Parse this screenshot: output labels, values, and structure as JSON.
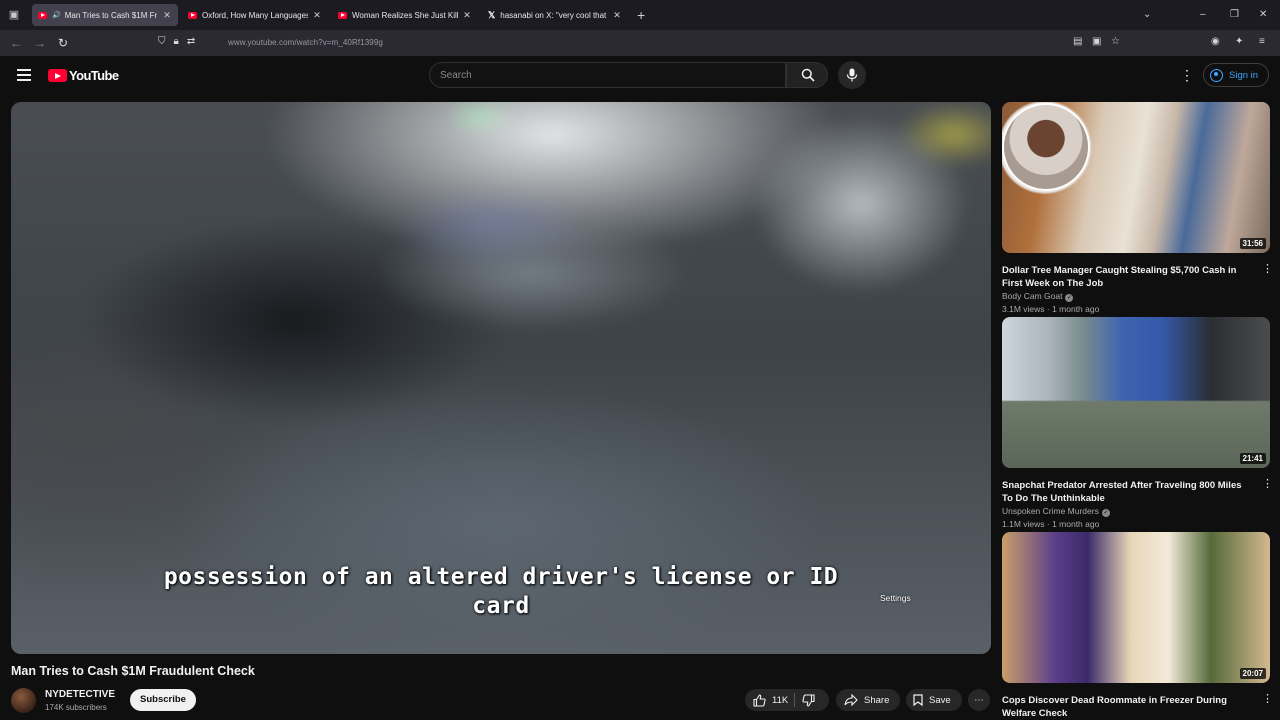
{
  "browser": {
    "tabs": [
      {
        "title": "Man Tries to Cash $1M Fr",
        "active": true,
        "type": "youtube"
      },
      {
        "title": "Oxford, How Many Languages I",
        "active": false,
        "type": "youtube"
      },
      {
        "title": "Woman Realizes She Just Killed",
        "active": false,
        "type": "youtube"
      },
      {
        "title": "hasanabi on X: \"very cool that e",
        "active": false,
        "type": "x"
      }
    ],
    "url": "www.youtube.com/watch?v=m_40Rf1399g"
  },
  "masthead": {
    "logo_text": "YouTube",
    "search_placeholder": "Search",
    "signin_label": "Sign in"
  },
  "player": {
    "caption_line1": "possession of an altered driver's license or ID",
    "caption_line2": "card",
    "settings_tooltip": "Settings"
  },
  "video": {
    "title": "Man Tries to Cash $1M Fraudulent Check",
    "channel_name": "NYDETECTIVE",
    "subscribers": "174K subscribers",
    "subscribe_label": "Subscribe",
    "likes": "11K",
    "share_label": "Share",
    "save_label": "Save"
  },
  "recommendations": [
    {
      "title": "Dollar Tree Manager Caught Stealing $5,700 Cash in First Week on The Job",
      "channel": "Body Cam Goat",
      "meta": "3.1M views · 1 month ago",
      "duration": "31:56",
      "verified": true
    },
    {
      "title": "Snapchat Predator Arrested After Traveling 800 Miles To Do The Unthinkable",
      "channel": "Unspoken Crime Murders",
      "meta": "1.1M views · 1 month ago",
      "duration": "21:41",
      "verified": true
    },
    {
      "title": "Cops Discover Dead Roommate in Freezer During Welfare Check",
      "channel": "",
      "meta": "",
      "duration": "20:07",
      "verified": false
    }
  ],
  "colors": {
    "brand_red": "#ff0033",
    "link_blue": "#3ea6ff",
    "background": "#0f0f0f"
  }
}
